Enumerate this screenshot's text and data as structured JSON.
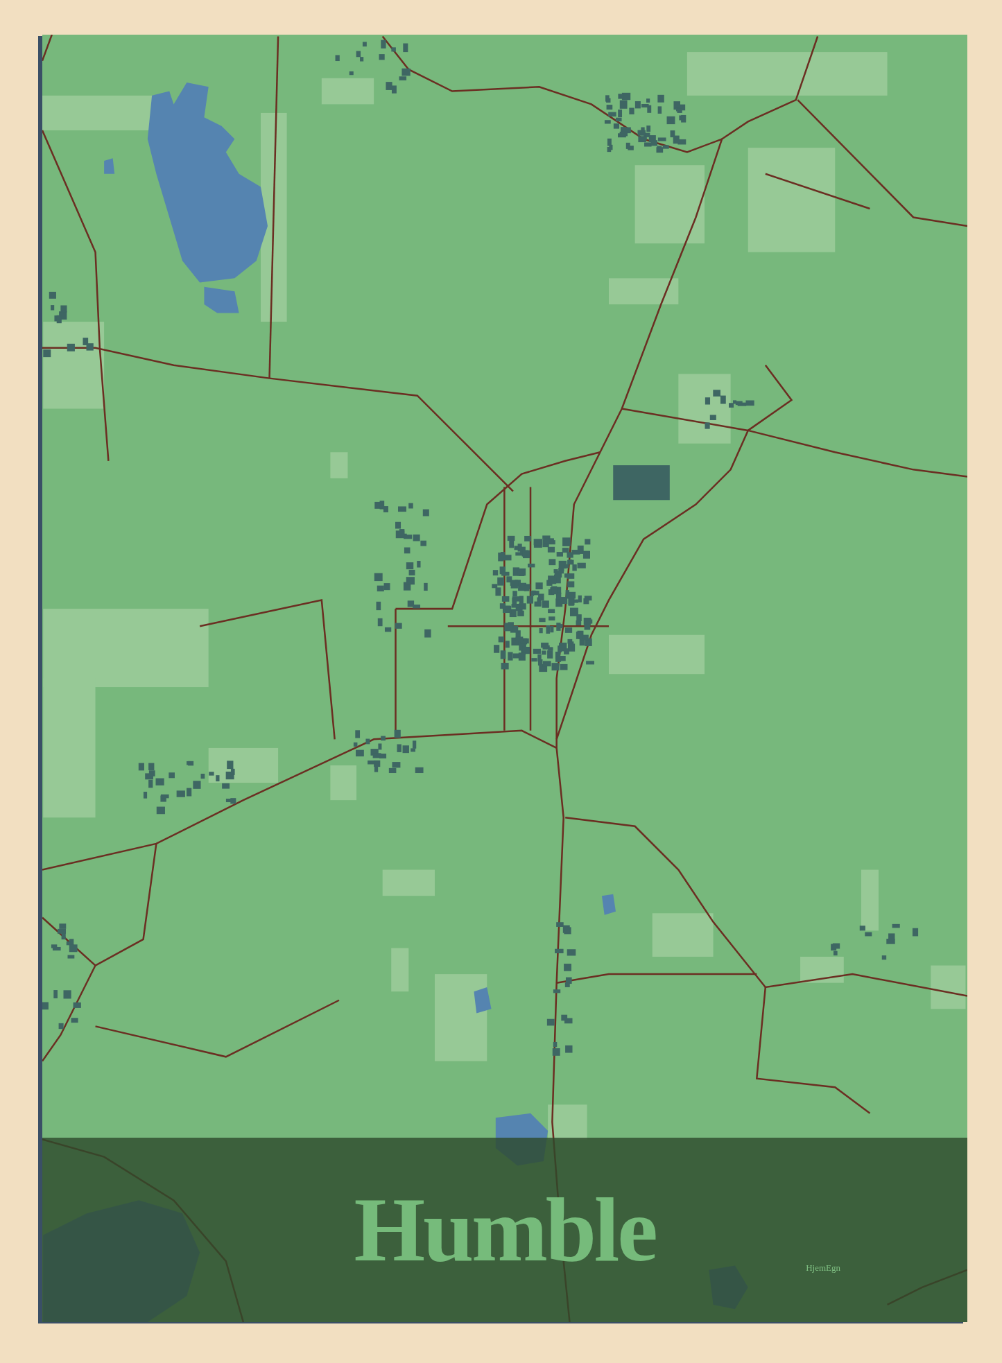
{
  "title": "Humble",
  "logo": "HjemEgn"
}
